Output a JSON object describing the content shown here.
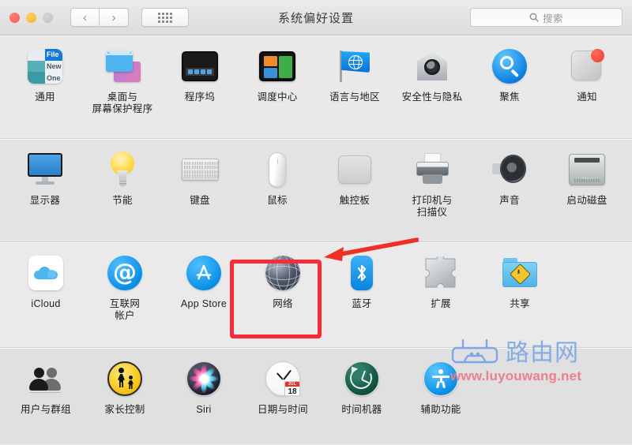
{
  "window": {
    "title": "系统偏好设置",
    "traffic_lights": [
      "close",
      "minimize",
      "zoom"
    ],
    "nav": {
      "back": "‹",
      "forward": "›",
      "grid_label": "show-all-grid"
    },
    "search": {
      "placeholder": "搜索",
      "value": ""
    }
  },
  "rows": [
    {
      "id": "row-personal",
      "items": [
        {
          "name": "general",
          "label": "通用",
          "icon": "general-icon"
        },
        {
          "name": "desktop",
          "label": "桌面与\n屏幕保护程序",
          "icon": "desktop-screensaver-icon"
        },
        {
          "name": "dock",
          "label": "程序坞",
          "icon": "dock-icon"
        },
        {
          "name": "mission-control",
          "label": "调度中心",
          "icon": "mission-control-icon"
        },
        {
          "name": "language",
          "label": "语言与地区",
          "icon": "language-flag-icon"
        },
        {
          "name": "security",
          "label": "安全性与隐私",
          "icon": "security-privacy-icon"
        },
        {
          "name": "spotlight",
          "label": "聚焦",
          "icon": "spotlight-icon"
        },
        {
          "name": "notifications",
          "label": "通知",
          "icon": "notifications-icon",
          "badge": true
        }
      ]
    },
    {
      "id": "row-hardware",
      "items": [
        {
          "name": "displays",
          "label": "显示器",
          "icon": "display-icon"
        },
        {
          "name": "energy",
          "label": "节能",
          "icon": "energy-saver-icon"
        },
        {
          "name": "keyboard",
          "label": "键盘",
          "icon": "keyboard-icon"
        },
        {
          "name": "mouse",
          "label": "鼠标",
          "icon": "mouse-icon"
        },
        {
          "name": "trackpad",
          "label": "触控板",
          "icon": "trackpad-icon"
        },
        {
          "name": "printers",
          "label": "打印机与\n扫描仪",
          "icon": "printer-scanner-icon"
        },
        {
          "name": "sound",
          "label": "声音",
          "icon": "sound-icon"
        },
        {
          "name": "startupdisk",
          "label": "启动磁盘",
          "icon": "startup-disk-icon"
        }
      ]
    },
    {
      "id": "row-internet",
      "items": [
        {
          "name": "icloud",
          "label": "iCloud",
          "icon": "icloud-icon"
        },
        {
          "name": "internet-accounts",
          "label": "互联网\n帐户",
          "icon": "at-sign-icon"
        },
        {
          "name": "app-store",
          "label": "App Store",
          "icon": "app-store-icon"
        },
        {
          "name": "network",
          "label": "网络",
          "icon": "network-globe-icon",
          "highlighted": true
        },
        {
          "name": "bluetooth",
          "label": "蓝牙",
          "icon": "bluetooth-icon"
        },
        {
          "name": "extensions",
          "label": "扩展",
          "icon": "puzzle-piece-icon"
        },
        {
          "name": "sharing",
          "label": "共享",
          "icon": "sharing-folder-icon"
        }
      ]
    },
    {
      "id": "row-system",
      "items": [
        {
          "name": "users-groups",
          "label": "用户与群组",
          "icon": "users-icon"
        },
        {
          "name": "parental",
          "label": "家长控制",
          "icon": "parental-control-icon"
        },
        {
          "name": "siri",
          "label": "Siri",
          "icon": "siri-icon"
        },
        {
          "name": "date-time",
          "label": "日期与时间",
          "icon": "clock-calendar-icon",
          "calendar_month": "JUL",
          "calendar_day": "18"
        },
        {
          "name": "time-machine",
          "label": "时间机器",
          "icon": "time-machine-icon"
        },
        {
          "name": "accessibility",
          "label": "辅助功能",
          "icon": "accessibility-icon"
        }
      ]
    }
  ],
  "annotations": {
    "highlight_color": "#fb2a38",
    "highlight_target": "网络",
    "arrow_color": "#ee3124"
  },
  "watermark": {
    "brand_cn": "路由网",
    "url": "www.luyouwang.net",
    "brand_color": "#7ea7e8",
    "url_color": "#ef7e8e"
  }
}
